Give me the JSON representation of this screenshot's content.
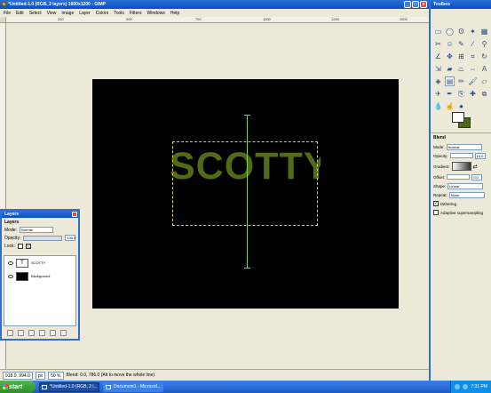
{
  "window": {
    "title": "*Untitled-1.0 (RGB, 2 layers) 1600x1200 - GIMP",
    "buttons": [
      "_",
      "□",
      "x"
    ]
  },
  "menu": [
    "File",
    "Edit",
    "Select",
    "View",
    "Image",
    "Layer",
    "Colors",
    "Tools",
    "Filters",
    "Windows",
    "Help"
  ],
  "rulers": {
    "top_labels": [
      "250",
      "500",
      "750",
      "1000",
      "1250",
      "1500"
    ]
  },
  "canvas": {
    "text_layer": "SCOTTY",
    "text_color": "#516b16",
    "background_color": "#000000",
    "guide_color": "#7ccd52"
  },
  "status": {
    "coords": "918.0, 994.0",
    "unit": "px",
    "zoom": "50 %",
    "message": "Blend: 0.0, 786.0 (Alt to move the whole line)"
  },
  "layers_dock": {
    "title": "Layers",
    "header": "Layers",
    "mode_label": "Mode:",
    "mode_value": "Normal",
    "opacity_label": "Opacity:",
    "opacity_value": "100.0",
    "opacity_fraction": 1.0,
    "lock_label": "Lock:",
    "layers": [
      {
        "name": "SCOTTY",
        "visible": true
      },
      {
        "name": "Background",
        "visible": true
      }
    ]
  },
  "toolbox": {
    "title": "Toolbox",
    "fg_color": "#ffffff",
    "bg_color": "#4d6b10",
    "blend": {
      "title": "Blend",
      "mode_label": "Mode:",
      "mode_value": "Normal",
      "opacity_label": "Opacity:",
      "opacity_value": "15.0",
      "gradient_label": "Gradient:",
      "offset_label": "Offset:",
      "offset_value": "0.0",
      "shape_label": "Shape:",
      "shape_value": "Linear",
      "repeat_label": "Repeat:",
      "repeat_value": "None",
      "dithering_label": "Dithering",
      "dithering_checked": true,
      "adaptive_label": "Adaptive supersampling",
      "adaptive_checked": false
    }
  },
  "taskbar": {
    "start_label": "start",
    "items": [
      "*Untitled-1.0 (RGB, 2 l...",
      "Document1 - Microsof..."
    ],
    "clock": "7:31 PM"
  }
}
